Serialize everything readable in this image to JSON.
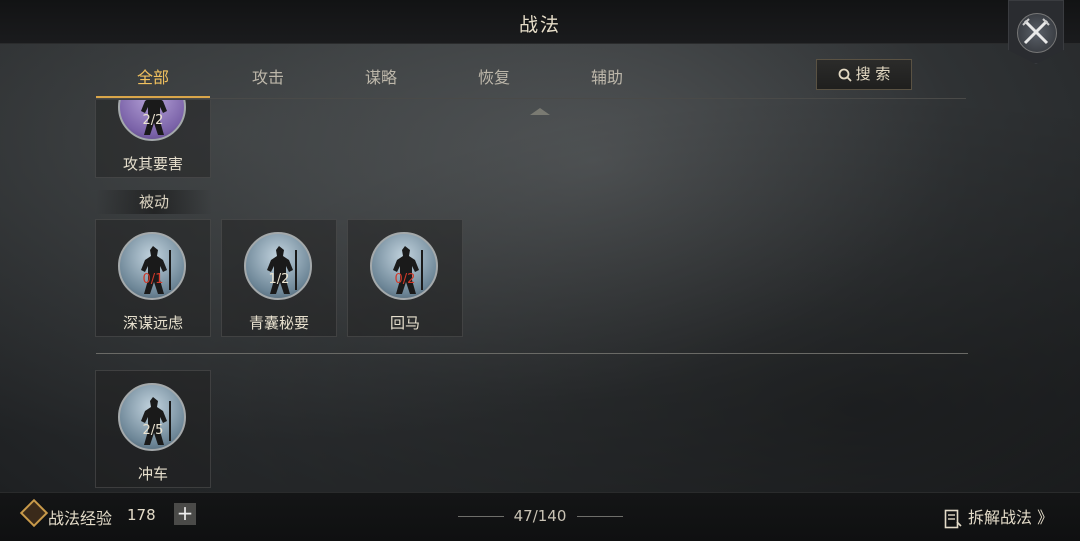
{
  "header": {
    "title": "战法"
  },
  "tabs": [
    {
      "label": "全部",
      "active": true
    },
    {
      "label": "攻击",
      "active": false
    },
    {
      "label": "谋略",
      "active": false
    },
    {
      "label": "恢复",
      "active": false
    },
    {
      "label": "辅助",
      "active": false
    }
  ],
  "search": {
    "label": "搜 索"
  },
  "cards_top": [
    {
      "name": "攻其要害",
      "count": "2/2"
    }
  ],
  "section": {
    "label": "被动"
  },
  "cards_passive": [
    {
      "name": "深谋远虑",
      "count": "0/1"
    },
    {
      "name": "青囊秘要",
      "count": "1/2"
    },
    {
      "name": "回马",
      "count": "0/2"
    }
  ],
  "cards_bottom": [
    {
      "name": "冲车",
      "count": "2/5"
    }
  ],
  "footer": {
    "exp_label": "战法经验",
    "exp_value": "178",
    "plus": "+",
    "page_count": "47/140",
    "dismantle_label": "拆解战法 》"
  },
  "colors": {
    "accent": "#f1c15e",
    "count_red": "#d23a2a"
  },
  "icons": [
    "close-swords-icon",
    "search-icon",
    "experience-icon",
    "plus-icon",
    "document-icon",
    "up-arrow-icon"
  ]
}
